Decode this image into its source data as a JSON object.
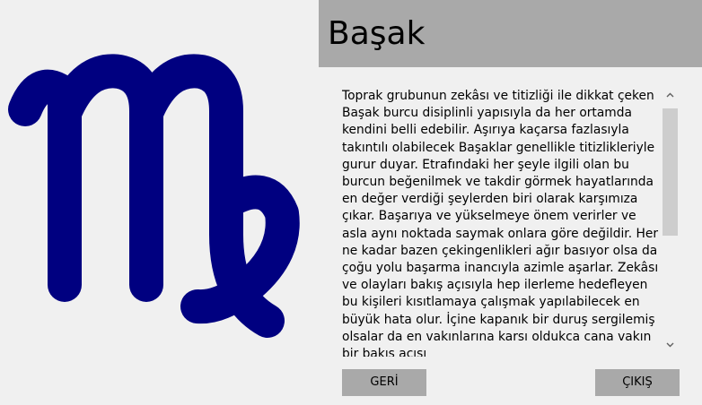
{
  "header": {
    "title": "Başak"
  },
  "symbol": {
    "icon": "virgo-zodiac-icon",
    "color": "#000080"
  },
  "description": {
    "text": "Toprak grubunun zekâsı ve titizliği ile dikkat çeken Başak burcu disiplinli yapısıyla da her ortamda kendini belli edebilir. Aşırıya kaçarsa fazlasıyla takıntılı olabilecek Başaklar genellikle titizlikleriyle gurur duyar. Etrafındaki her şeyle ilgili olan bu burcun beğenilmek ve takdir görmek hayatlarında en değer verdiği şeylerden biri olarak karşımıza çıkar. Başarıya ve yükselmeye önem verirler ve asla aynı noktada saymak onlara göre değildir. Her ne kadar bazen çekingenlikleri ağır basıyor olsa da çoğu yolu başarma inancıyla azimle aşarlar. Zekâsı ve olayları bakış açısıyla hep ilerleme hedefleyen bu kişileri kısıtlamaya çalışmak yapılabilecek en büyük hata olur. İçine kapanık bir duruş sergilemiş olsalar da en vakınlarına karsı oldukca cana vakın bir bakıs acısı"
  },
  "buttons": {
    "back": "GERİ",
    "exit": "ÇIKIŞ"
  },
  "colors": {
    "background": "#f0f0f0",
    "header": "#a9a9a9",
    "button": "#a9a9a9",
    "symbol": "#000080"
  }
}
